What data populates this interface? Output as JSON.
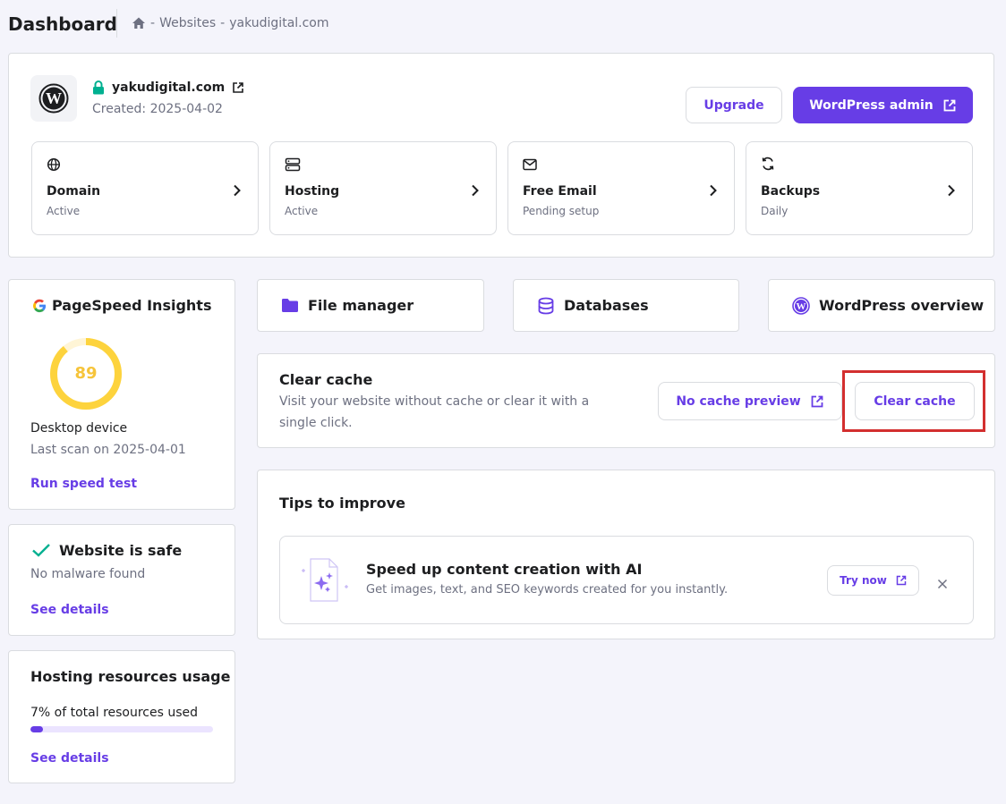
{
  "header": {
    "title": "Dashboard",
    "breadcrumb_sep1": "-",
    "breadcrumb_websites": "Websites",
    "breadcrumb_sep2": "-",
    "breadcrumb_site": "yakudigital.com"
  },
  "site": {
    "domain": "yakudigital.com",
    "created": "Created: 2025-04-02",
    "upgrade_label": "Upgrade",
    "wp_admin_label": "WordPress admin"
  },
  "services": [
    {
      "icon": "globe-icon",
      "label": "Domain",
      "status": "Active"
    },
    {
      "icon": "server-icon",
      "label": "Hosting",
      "status": "Active"
    },
    {
      "icon": "mail-icon",
      "label": "Free Email",
      "status": "Pending setup"
    },
    {
      "icon": "refresh-icon",
      "label": "Backups",
      "status": "Daily"
    }
  ],
  "pagespeed": {
    "title": "PageSpeed Insights",
    "score": "89",
    "score_value": 89,
    "device": "Desktop device",
    "last_scan": "Last scan on 2025-04-01",
    "run_label": "Run speed test"
  },
  "security": {
    "title": "Website is safe",
    "subtitle": "No malware found",
    "link": "See details"
  },
  "resources": {
    "title": "Hosting resources usage",
    "usage_text": "7% of total resources used",
    "usage_percent": 7,
    "link": "See details"
  },
  "quick_links": [
    {
      "icon": "folder-icon",
      "label": "File manager"
    },
    {
      "icon": "database-icon",
      "label": "Databases"
    },
    {
      "icon": "wordpress-icon",
      "label": "WordPress overview"
    }
  ],
  "cache": {
    "title": "Clear cache",
    "description": "Visit your website without cache or clear it with a single click.",
    "preview_label": "No cache preview",
    "clear_label": "Clear cache"
  },
  "tips": {
    "title": "Tips to improve",
    "item_title": "Speed up content creation with AI",
    "item_desc": "Get images, text, and SEO keywords created for you instantly.",
    "try_label": "Try now"
  },
  "colors": {
    "accent": "#673de6",
    "background": "#f4f4fb",
    "score": "#fdd33d",
    "success": "#00b090",
    "highlight": "#d32f2f"
  }
}
